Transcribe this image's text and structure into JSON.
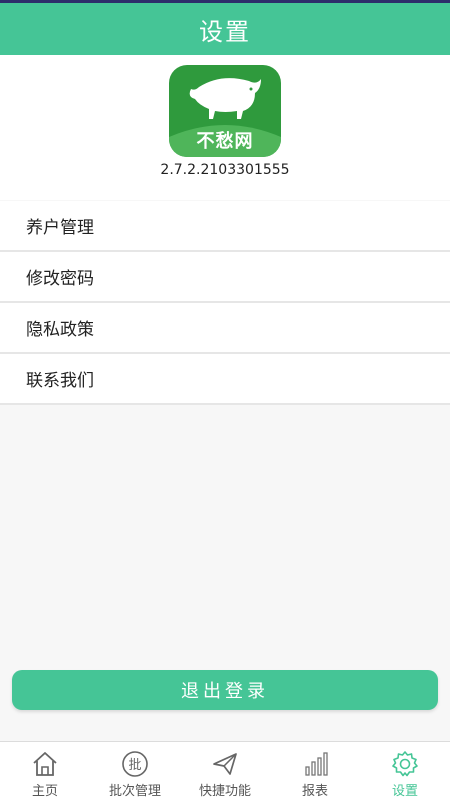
{
  "header": {
    "title": "设置"
  },
  "app": {
    "logo_text": "不愁网",
    "version": "2.7.2.2103301555"
  },
  "menu": {
    "items": [
      {
        "label": "养户管理"
      },
      {
        "label": "修改密码"
      },
      {
        "label": "隐私政策"
      },
      {
        "label": "联系我们"
      }
    ]
  },
  "logout": {
    "label": "退出登录"
  },
  "tabbar": {
    "items": [
      {
        "label": "主页",
        "icon": "home-icon"
      },
      {
        "label": "批次管理",
        "icon": "batch-icon",
        "icon_text": "批"
      },
      {
        "label": "快捷功能",
        "icon": "paper-plane-icon"
      },
      {
        "label": "报表",
        "icon": "bar-chart-icon"
      },
      {
        "label": "设置",
        "icon": "gear-icon",
        "active": true
      }
    ]
  },
  "colors": {
    "accent": "#45c596",
    "logo_green": "#2f9a3d",
    "page_bg": "#f7f7f7"
  }
}
